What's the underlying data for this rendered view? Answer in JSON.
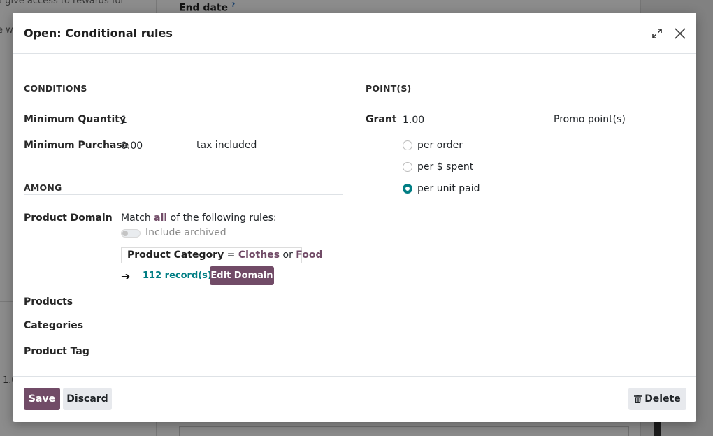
{
  "background": {
    "left_text_1": "t give access to rewards for",
    "left_text_2": "e w",
    "left_value": "1.0",
    "end_date_label": "End date",
    "help_mark": "?"
  },
  "dialog": {
    "title": "Open: Conditional rules",
    "conditions": {
      "title": "CONDITIONS",
      "min_qty_label": "Minimum Quantity",
      "min_qty_value": "1",
      "min_purchase_label": "Minimum Purchase",
      "min_purchase_value": "0.00",
      "tax_label": "tax included"
    },
    "points": {
      "title": "POINT(S)",
      "grant_label": "Grant",
      "grant_value": "1.00",
      "unit_label": "Promo point(s)",
      "options": [
        {
          "label": "per order",
          "checked": false
        },
        {
          "label": "per $ spent",
          "checked": false
        },
        {
          "label": "per unit paid",
          "checked": true
        }
      ]
    },
    "among": {
      "title": "AMONG",
      "product_domain_label": "Product Domain",
      "match_prefix": "Match",
      "match_all": "all",
      "match_suffix": "of the following rules:",
      "include_archived": "Include archived",
      "domain_field": "Product Category",
      "domain_operator": "=",
      "domain_value_1": "Clothes",
      "domain_connector": "or",
      "domain_value_2": "Food",
      "arrow": "➔",
      "records": "112 record(s)",
      "edit_domain": "Edit Domain",
      "products_label": "Products",
      "categories_label": "Categories",
      "product_tag_label": "Product Tag"
    },
    "footer": {
      "save": "Save",
      "discard": "Discard",
      "delete": "Delete"
    }
  },
  "colors": {
    "primary": "#714b67",
    "accent": "#017e84"
  },
  "icons": {
    "expand": "expand-icon",
    "close": "close-icon",
    "trash": "trash-icon",
    "arrow": "arrow-right-icon"
  }
}
